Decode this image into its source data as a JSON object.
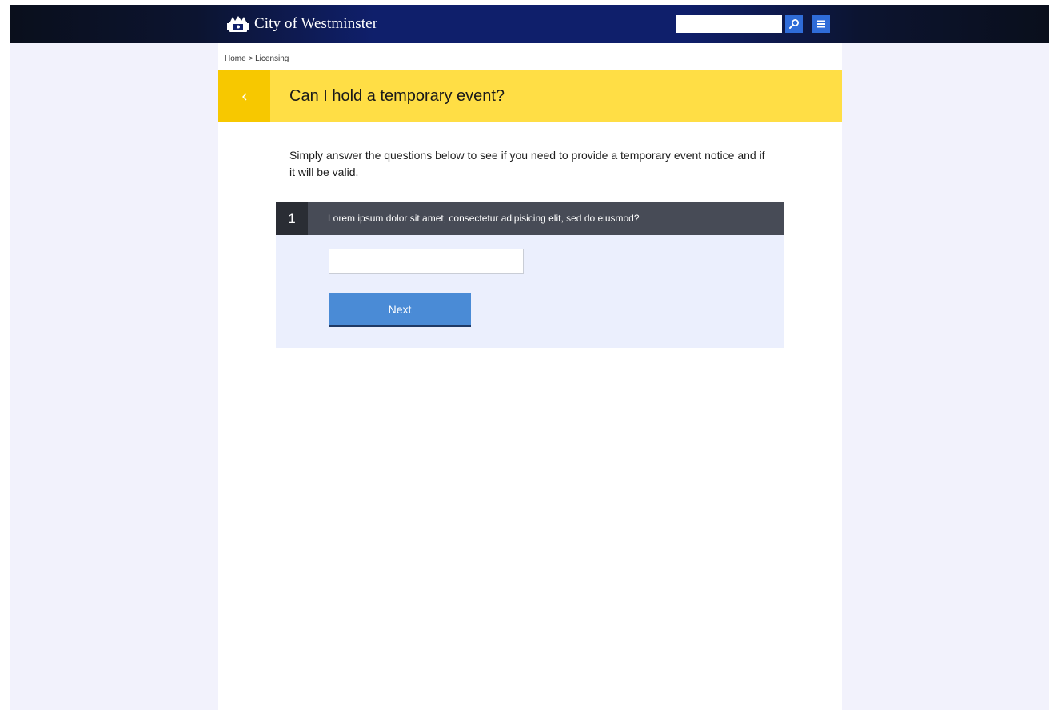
{
  "header": {
    "logo_text": "City of Westminster",
    "search": {
      "value": "",
      "placeholder": ""
    },
    "search_button_icon": "search-icon",
    "menu_button_icon": "hamburger-menu-icon"
  },
  "breadcrumb": {
    "items": [
      "Home",
      "Licensing"
    ],
    "separator": ">"
  },
  "page": {
    "title": "Can I hold a temporary event?",
    "back_icon": "chevron-left-icon",
    "intro": "Simply answer the questions below to see if you need to provide a temporary event notice and if it will be valid."
  },
  "question": {
    "number": "1",
    "text": "Lorem ipsum dolor sit amet, consectetur adipisicing elit, sed do eiusmod?",
    "answer_value": "",
    "answer_placeholder": "",
    "next_label": "Next"
  },
  "colors": {
    "header_bg": "#0f1f6b",
    "title_bar": "#ffde45",
    "back_button": "#f7c800",
    "question_header": "#474b56",
    "question_number_bg": "#2a2d34",
    "question_body": "#ebeffd",
    "next_button": "#4a8bd6",
    "page_bg": "#f2f2fc"
  }
}
